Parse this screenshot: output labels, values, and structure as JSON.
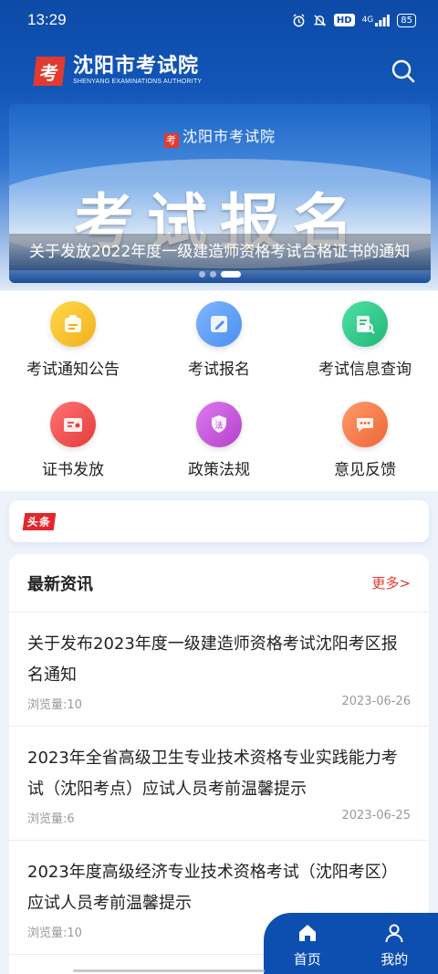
{
  "status_bar": {
    "time": "13:29",
    "network": "4G",
    "hd": "HD",
    "battery": "85",
    "icons": [
      "alarm-icon",
      "mute-icon",
      "hd-icon",
      "signal-icon",
      "battery-icon"
    ]
  },
  "app": {
    "logo_mark": "考",
    "name_cn": "沈阳市考试院",
    "name_en": "SHENYANG EXAMINATIONS AUTHORITY",
    "search_icon": "search-icon",
    "brand_color": "#0d4fb0",
    "accent_red": "#e23a2e"
  },
  "banner": {
    "logo_text": "沈阳市考试院",
    "big_text": "考试报名",
    "caption": "关于发放2022年度一级建造师资格考试合格证书的通知",
    "slide_count": 3,
    "active_slide": 3
  },
  "menu": [
    {
      "label": "考试通知公告",
      "icon": "notice-icon",
      "color": "#f6c22a"
    },
    {
      "label": "考试报名",
      "icon": "edit-form-icon",
      "color": "#5a9ef5"
    },
    {
      "label": "考试信息查询",
      "icon": "search-doc-icon",
      "color": "#2fc98a"
    },
    {
      "label": "证书发放",
      "icon": "certificate-icon",
      "color": "#ef5252"
    },
    {
      "label": "政策法规",
      "icon": "law-shield-icon",
      "color": "#c557d8"
    },
    {
      "label": "意见反馈",
      "icon": "chat-icon",
      "color": "#f47a4c"
    }
  ],
  "headline": {
    "tag": "头条"
  },
  "news": {
    "title": "最新资讯",
    "more": "更多>",
    "items": [
      {
        "title": "关于发布2023年度一级建造师资格考试沈阳考区报名通知",
        "views": "浏览量:10",
        "date": "2023-06-26"
      },
      {
        "title": "2023年全省高级卫生专业技术资格专业实践能力考试（沈阳考点）应试人员考前温馨提示",
        "views": "浏览量:6",
        "date": "2023-06-25"
      },
      {
        "title": "2023年度高级经济专业技术资格考试（沈阳考区）应试人员考前温馨提示",
        "views": "浏览量:10",
        "date": ""
      }
    ]
  },
  "bottom_nav": [
    {
      "label": "首页",
      "icon": "home-icon",
      "active": true
    },
    {
      "label": "我的",
      "icon": "user-icon",
      "active": false
    }
  ]
}
